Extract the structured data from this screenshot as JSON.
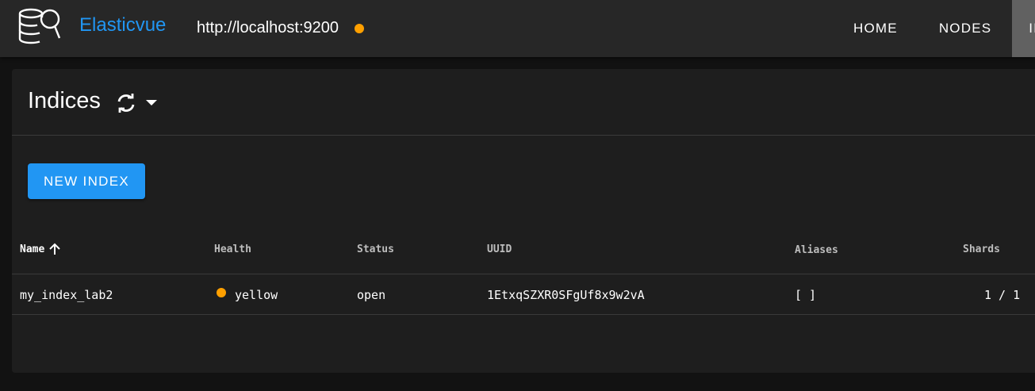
{
  "app": {
    "brand": "Elasticvue",
    "cluster_url": "http://localhost:9200",
    "cluster_status_color": "#ffa000",
    "accent_color": "#2196f3"
  },
  "nav": {
    "items": [
      {
        "label": "HOME",
        "active": false
      },
      {
        "label": "NODES",
        "active": false
      },
      {
        "label": "IND",
        "active": true
      }
    ]
  },
  "page": {
    "title": "Indices",
    "refresh_icon": "refresh-icon",
    "menu_icon": "caret-down-icon",
    "new_index_label": "NEW INDEX"
  },
  "table": {
    "columns": [
      {
        "label": "Name",
        "sorted": "asc"
      },
      {
        "label": "Health"
      },
      {
        "label": "Status"
      },
      {
        "label": "UUID"
      },
      {
        "label": "Aliases"
      },
      {
        "label": "Shards"
      }
    ],
    "rows": [
      {
        "name": "my_index_lab2",
        "health": "yellow",
        "health_color": "#ffa000",
        "status": "open",
        "uuid": "1EtxqSZXR0SFgUf8x9w2vA",
        "aliases": "[ ]",
        "shards": "1 / 1"
      }
    ]
  }
}
